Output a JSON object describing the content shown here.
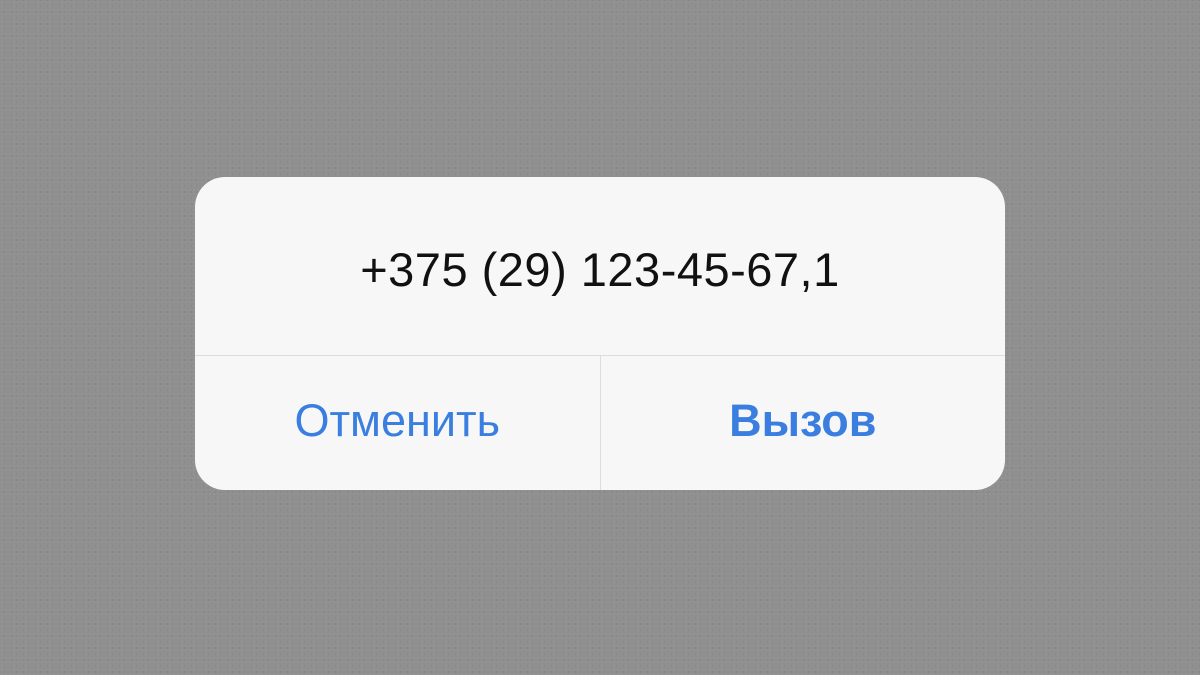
{
  "dialog": {
    "title": "+375 (29) 123-45-67,1",
    "cancel_label": "Отменить",
    "call_label": "Вызов"
  },
  "colors": {
    "accent": "#3a7ee0",
    "background": "#8f8f8f",
    "dialog_bg": "#f7f7f7"
  }
}
